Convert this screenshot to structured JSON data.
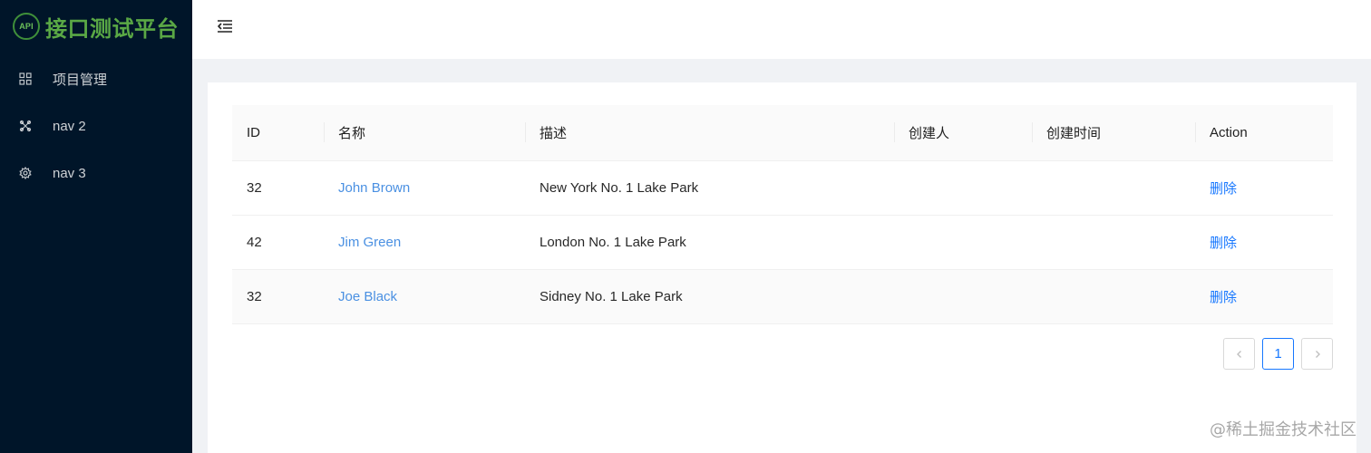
{
  "app": {
    "logo_badge": "API",
    "logo_title": "接口测试平台"
  },
  "sidebar": {
    "items": [
      {
        "label": "项目管理",
        "icon": "appstore-icon"
      },
      {
        "label": "nav 2",
        "icon": "video-icon"
      },
      {
        "label": "nav 3",
        "icon": "setting-icon"
      }
    ]
  },
  "table": {
    "columns": [
      "ID",
      "名称",
      "描述",
      "创建人",
      "创建时间",
      "Action"
    ],
    "rows": [
      {
        "id": "32",
        "name": "John Brown",
        "desc": "New York No. 1 Lake Park",
        "creator": "",
        "created": "",
        "action": "删除"
      },
      {
        "id": "42",
        "name": "Jim Green",
        "desc": "London No. 1 Lake Park",
        "creator": "",
        "created": "",
        "action": "删除"
      },
      {
        "id": "32",
        "name": "Joe Black",
        "desc": "Sidney No. 1 Lake Park",
        "creator": "",
        "created": "",
        "action": "删除"
      }
    ]
  },
  "pagination": {
    "current": "1"
  },
  "watermark": "@稀土掘金技术社区",
  "colors": {
    "sider_bg": "#001529",
    "link": "#1677ff",
    "logo_green": "#5aa845"
  }
}
